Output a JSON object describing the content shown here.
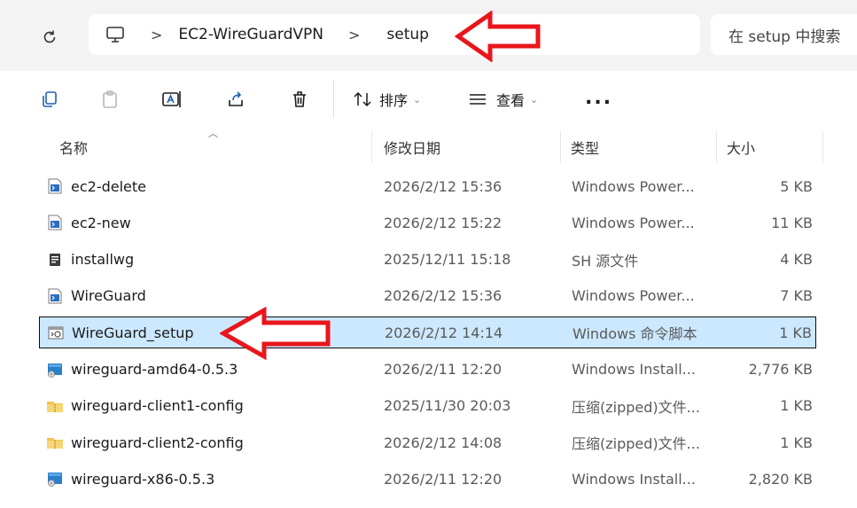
{
  "address_bar": {
    "breadcrumbs": [
      "EC2-WireGuardVPN",
      "setup"
    ],
    "separator": ">",
    "search_placeholder": "在 setup 中搜索"
  },
  "toolbar": {
    "sort_label": "排序",
    "view_label": "查看",
    "more_label": "..."
  },
  "columns": {
    "name": "名称",
    "modified": "修改日期",
    "type": "类型",
    "size": "大小"
  },
  "files": [
    {
      "name": "ec2-delete",
      "modified": "2026/2/12 15:36",
      "type": "Windows Power...",
      "size": "5 KB",
      "icon": "powershell-script-icon"
    },
    {
      "name": "ec2-new",
      "modified": "2026/2/12 15:22",
      "type": "Windows Power...",
      "size": "11 KB",
      "icon": "powershell-script-icon"
    },
    {
      "name": "installwg",
      "modified": "2025/12/11 15:18",
      "type": "SH 源文件",
      "size": "4 KB",
      "icon": "sh-file-icon"
    },
    {
      "name": "WireGuard",
      "modified": "2026/2/12 15:36",
      "type": "Windows Power...",
      "size": "7 KB",
      "icon": "powershell-script-icon"
    },
    {
      "name": "WireGuard_setup",
      "modified": "2026/2/12 14:14",
      "type": "Windows 命令脚本",
      "size": "1 KB",
      "icon": "batch-script-icon",
      "selected": true
    },
    {
      "name": "wireguard-amd64-0.5.3",
      "modified": "2026/2/11 12:20",
      "type": "Windows Install...",
      "size": "2,776 KB",
      "icon": "msi-installer-icon"
    },
    {
      "name": "wireguard-client1-config",
      "modified": "2025/11/30 20:03",
      "type": "压缩(zipped)文件...",
      "size": "1 KB",
      "icon": "zip-folder-icon"
    },
    {
      "name": "wireguard-client2-config",
      "modified": "2026/2/12 14:08",
      "type": "压缩(zipped)文件...",
      "size": "1 KB",
      "icon": "zip-folder-icon"
    },
    {
      "name": "wireguard-x86-0.5.3",
      "modified": "2026/2/11 12:20",
      "type": "Windows Install...",
      "size": "2,820 KB",
      "icon": "msi-installer-icon"
    }
  ],
  "colors": {
    "selection": "#cce8ff",
    "annotation_arrow": "#e8161b",
    "address_strip": "#f3f3f3"
  }
}
